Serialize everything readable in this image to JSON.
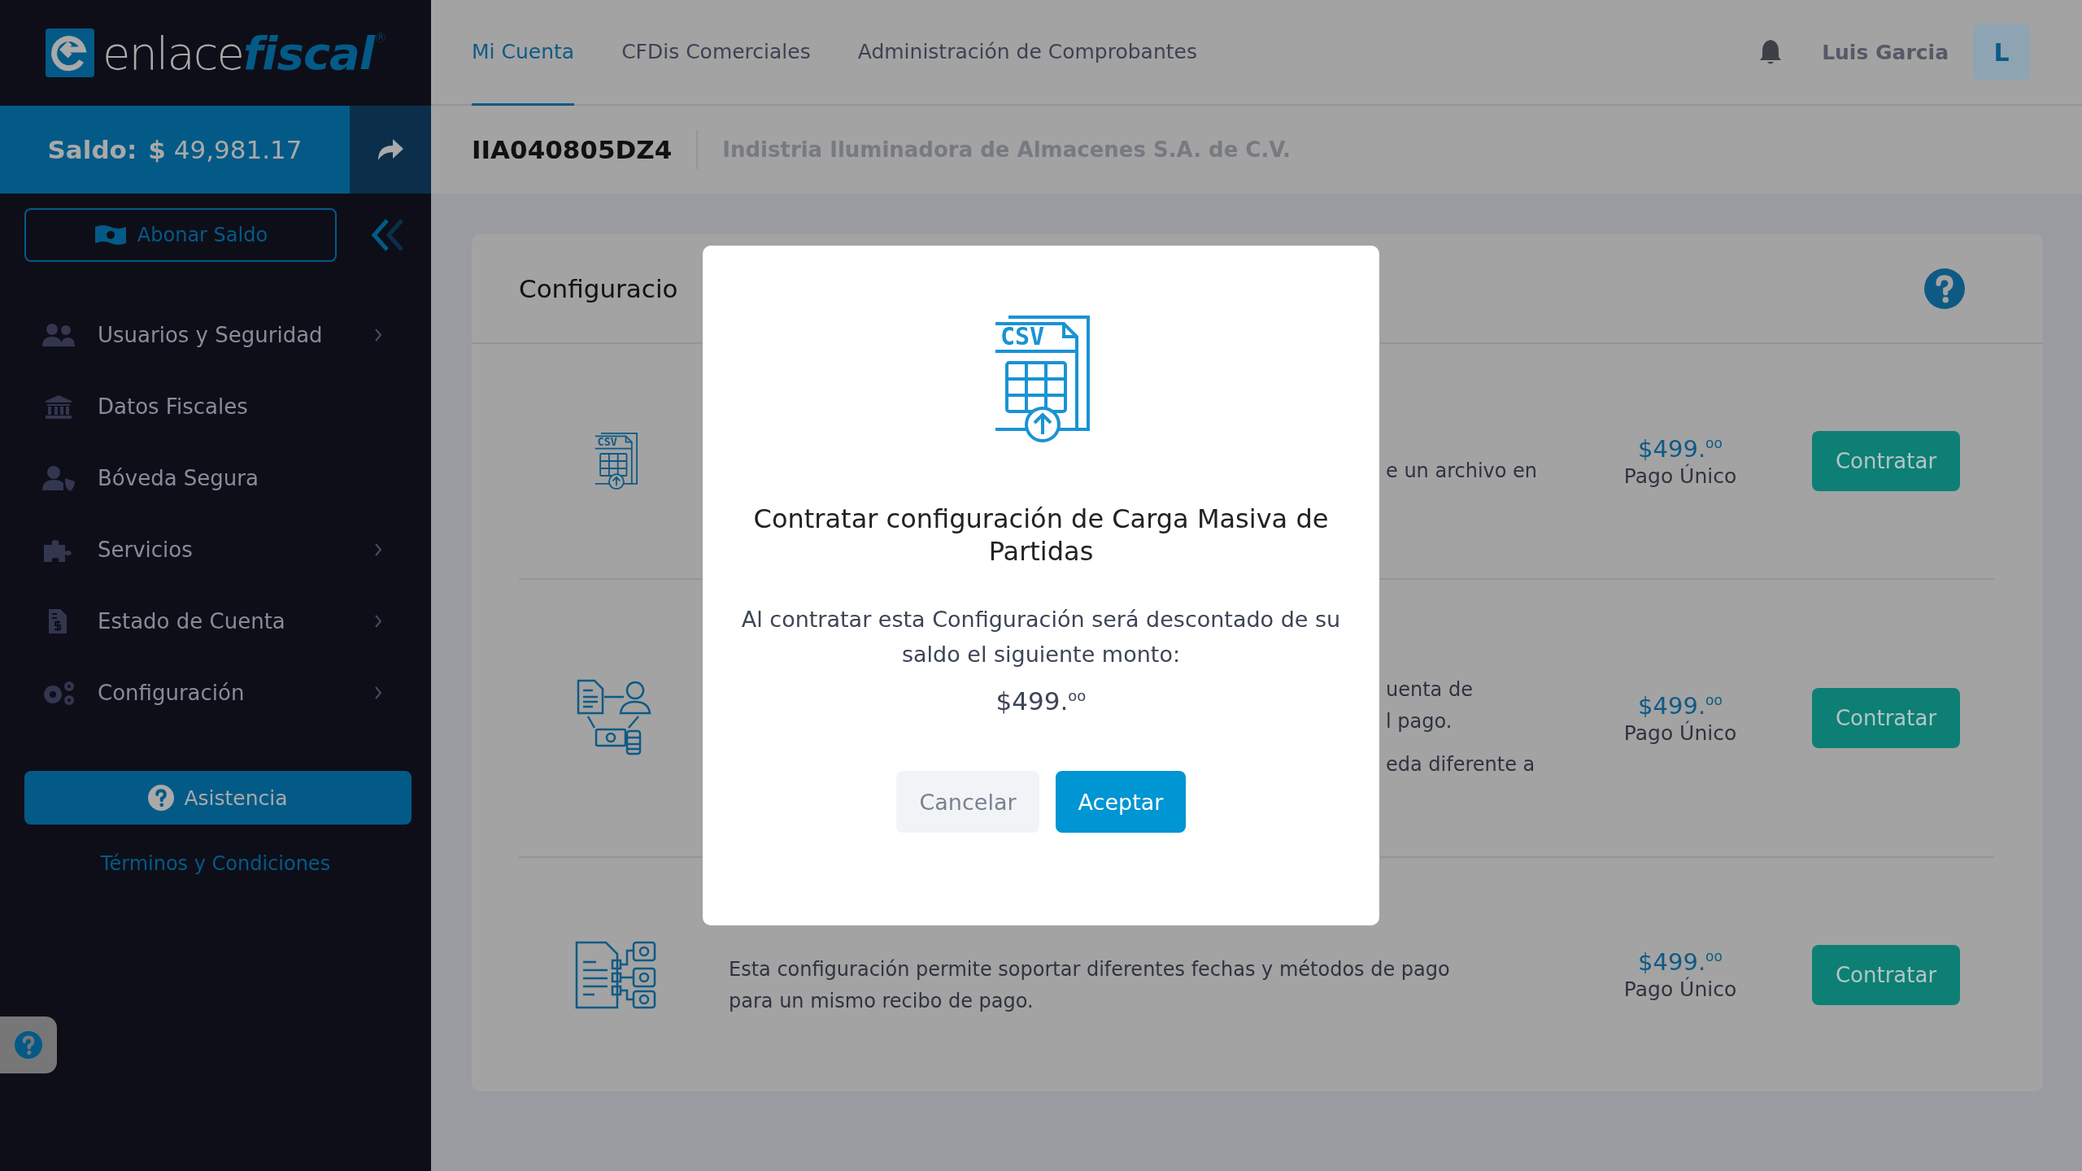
{
  "logo": {
    "word": "enlace",
    "accent": "fiscal",
    "mark": "®"
  },
  "balance": {
    "label": "Saldo:",
    "currency": "$",
    "amount": "49,981.17"
  },
  "top_up_button": "Abonar Saldo",
  "sidebar": {
    "items": [
      {
        "label": "Usuarios y Seguridad",
        "has_submenu": true
      },
      {
        "label": "Datos Fiscales",
        "has_submenu": false
      },
      {
        "label": "Bóveda Segura",
        "has_submenu": false
      },
      {
        "label": "Servicios",
        "has_submenu": true
      },
      {
        "label": "Estado de Cuenta",
        "has_submenu": true
      },
      {
        "label": "Configuración",
        "has_submenu": true
      }
    ]
  },
  "assist_button": "Asistencia",
  "terms_link": "Términos y Condiciones",
  "nav": {
    "tabs": [
      {
        "label": "Mi Cuenta",
        "selected": true
      },
      {
        "label": "CFDis Comerciales",
        "selected": false
      },
      {
        "label": "Administración de Comprobantes",
        "selected": false
      }
    ]
  },
  "user": {
    "name": "Luis Garcia",
    "initial": "L"
  },
  "company": {
    "rfc": "IIA040805DZ4",
    "name": "Indistria Iluminadora de Almacenes S.A. de C.V."
  },
  "card": {
    "title": "Configuracio",
    "rows": [
      {
        "kind": "clipped",
        "icon_label": "CSV",
        "paragraphs": [
          [
            "e un archivo en"
          ]
        ],
        "price": "$499.$^{oo}$",
        "price_note": "Pago Único",
        "button": "Contratar"
      },
      {
        "kind": "clipped",
        "paragraphs": [
          [
            "uenta de",
            "l pago."
          ],
          [
            "eda diferente a"
          ]
        ],
        "price": "$499.$^{oo}$",
        "price_note": "Pago Único",
        "button": "Contratar"
      },
      {
        "kind": "full",
        "paragraphs": [
          [
            "Esta configuración permite soportar diferentes fechas y métodos de pago",
            "para un mismo recibo de pago."
          ]
        ],
        "price": "$499.$^{oo}$",
        "price_note": "Pago Único",
        "button": "Contratar"
      }
    ]
  },
  "modal": {
    "icon_label": "CSV",
    "title": "Contratar configuración de Carga Masiva de Partidas",
    "message": "Al contratar esta Configuración será descontado de su saldo el siguiente monto:",
    "amount": "$499.$^{oo}$",
    "buttons": [
      {
        "label": "Cancelar",
        "kind": "secondary"
      },
      {
        "label": "Aceptar",
        "kind": "primary"
      }
    ]
  }
}
